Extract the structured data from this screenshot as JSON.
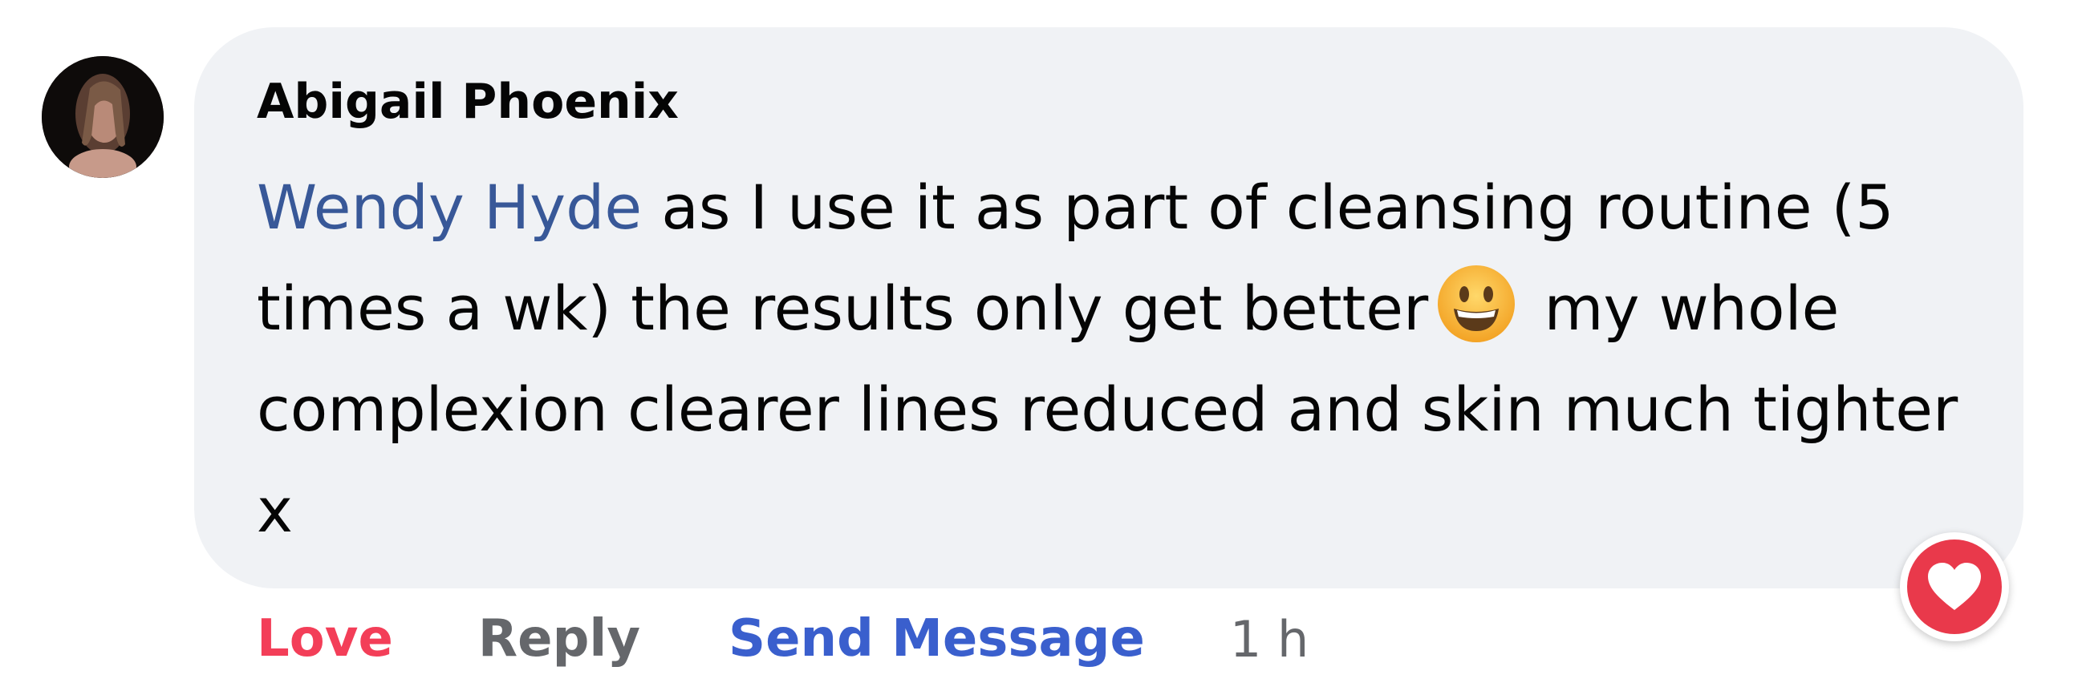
{
  "comment": {
    "author": "Abigail Phoenix",
    "mention": "Wendy Hyde",
    "text_part1": " as I use it as part of cleansing routine (5 times a wk) the results only get better",
    "emoji": "grinning-face-emoji",
    "text_part2": " my whole complexion clearer lines reduced and skin much tighter x",
    "reaction_icon": "heart-reaction-icon",
    "reaction_color": "#e9394b"
  },
  "actions": {
    "love_label": "Love",
    "reply_label": "Reply",
    "send_message_label": "Send Message",
    "timestamp": "1 h"
  },
  "colors": {
    "bubble_background": "#f0f2f5",
    "mention": "#385898",
    "love": "#f33e58",
    "send_message": "#3a5fcd",
    "muted": "#65676b"
  }
}
